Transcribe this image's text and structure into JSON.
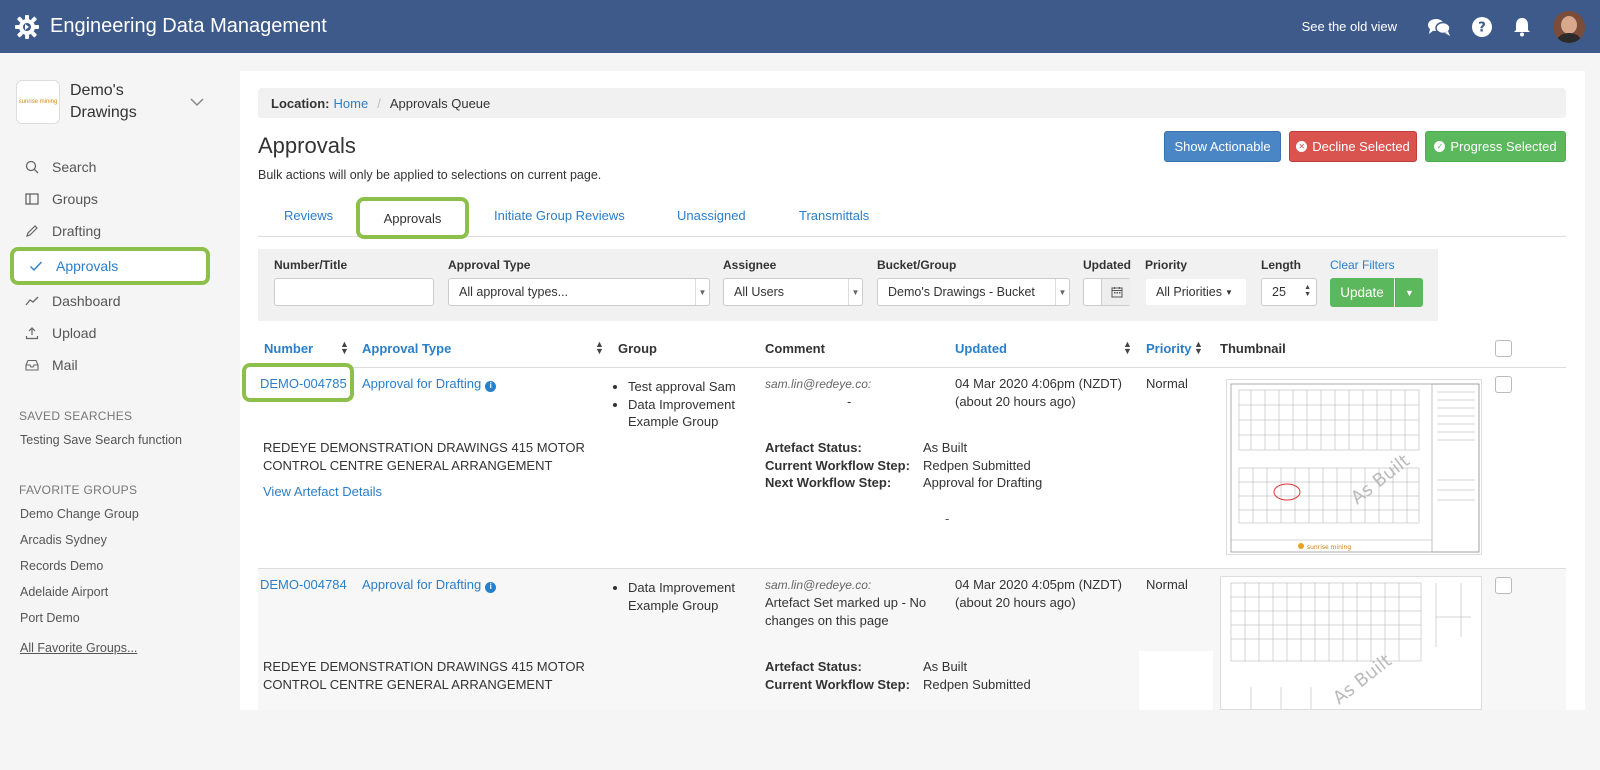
{
  "topbar": {
    "title": "Engineering Data Management",
    "old_view": "See the old view"
  },
  "sidebar": {
    "org_name": "Demo's Drawings",
    "org_logo_text": "sunrise mining",
    "nav": [
      {
        "label": "Search",
        "icon": "search-icon"
      },
      {
        "label": "Groups",
        "icon": "groups-icon"
      },
      {
        "label": "Drafting",
        "icon": "pencil-icon"
      },
      {
        "label": "Approvals",
        "icon": "check-icon",
        "active": true
      },
      {
        "label": "Dashboard",
        "icon": "chart-line-icon"
      },
      {
        "label": "Upload",
        "icon": "upload-icon"
      },
      {
        "label": "Mail",
        "icon": "mail-icon"
      }
    ],
    "saved_searches_title": "SAVED SEARCHES",
    "saved_searches": [
      "Testing Save Search function"
    ],
    "favorite_groups_title": "FAVORITE GROUPS",
    "favorite_groups": [
      "Demo Change Group",
      "Arcadis Sydney",
      "Records Demo",
      "Adelaide Airport",
      "Port Demo"
    ],
    "all_favorite_groups": "All Favorite Groups..."
  },
  "breadcrumb": {
    "label": "Location:",
    "home": "Home",
    "current": "Approvals Queue"
  },
  "page": {
    "title": "Approvals",
    "bulk_note": "Bulk actions will only be applied to selections on current page.",
    "show_actionable": "Show Actionable",
    "decline_selected": "Decline Selected",
    "progress_selected": "Progress Selected"
  },
  "tabs": [
    "Reviews",
    "Approvals",
    "Initiate Group Reviews",
    "Unassigned",
    "Transmittals"
  ],
  "filters": {
    "number_title_label": "Number/Title",
    "number_title_value": "",
    "approval_type_label": "Approval Type",
    "approval_type_value": "All approval types...",
    "assignee_label": "Assignee",
    "assignee_value": "All Users",
    "bucket_label": "Bucket/Group",
    "bucket_value": "Demo's Drawings - Bucket",
    "updated_label": "Updated",
    "priority_label": "Priority",
    "priority_value": "All Priorities",
    "length_label": "Length",
    "length_value": "25",
    "clear_filters": "Clear Filters",
    "update": "Update"
  },
  "table": {
    "headers": {
      "number": "Number",
      "approval_type": "Approval Type",
      "group": "Group",
      "comment": "Comment",
      "updated": "Updated",
      "priority": "Priority",
      "thumbnail": "Thumbnail"
    },
    "rows": [
      {
        "number": "DEMO-004785",
        "approval_type": "Approval for Drafting",
        "groups": [
          "Test approval Sam",
          "Data Improvement Example Group"
        ],
        "comment_email": "sam.lin@redeye.co:",
        "comment": "-",
        "updated": "04 Mar 2020 4:06pm (NZDT)",
        "updated_rel": "(about 20 hours ago)",
        "priority": "Normal",
        "title": "REDEYE DEMONSTRATION DRAWINGS 415 MOTOR CONTROL CENTRE GENERAL ARRANGEMENT",
        "view_details": "View Artefact Details",
        "artefact_status_label": "Artefact Status:",
        "artefact_status": "As Built",
        "current_step_label": "Current Workflow Step:",
        "current_step": "Redpen Submitted",
        "next_step_label": "Next Workflow Step:",
        "next_step": "Approval for Drafting",
        "extra": "-",
        "watermark": "As Built"
      },
      {
        "number": "DEMO-004784",
        "approval_type": "Approval for Drafting",
        "groups": [
          "Data Improvement Example Group"
        ],
        "comment_email": "sam.lin@redeye.co:",
        "comment": "Artefact Set marked up - No changes on this page",
        "updated": "04 Mar 2020 4:05pm (NZDT)",
        "updated_rel": "(about 20 hours ago)",
        "priority": "Normal",
        "title": "REDEYE DEMONSTRATION DRAWINGS 415 MOTOR CONTROL CENTRE GENERAL ARRANGEMENT",
        "artefact_status_label": "Artefact Status:",
        "artefact_status": "As Built",
        "current_step_label": "Current Workflow Step:",
        "current_step": "Redpen Submitted",
        "watermark": "As Built"
      }
    ]
  },
  "colors": {
    "topbar": "#3d5a8a",
    "link": "#2a7fc9",
    "highlight": "#8dc04a",
    "btn_blue": "#4a86c5",
    "btn_red": "#d9534f",
    "btn_green": "#5cb85c"
  }
}
